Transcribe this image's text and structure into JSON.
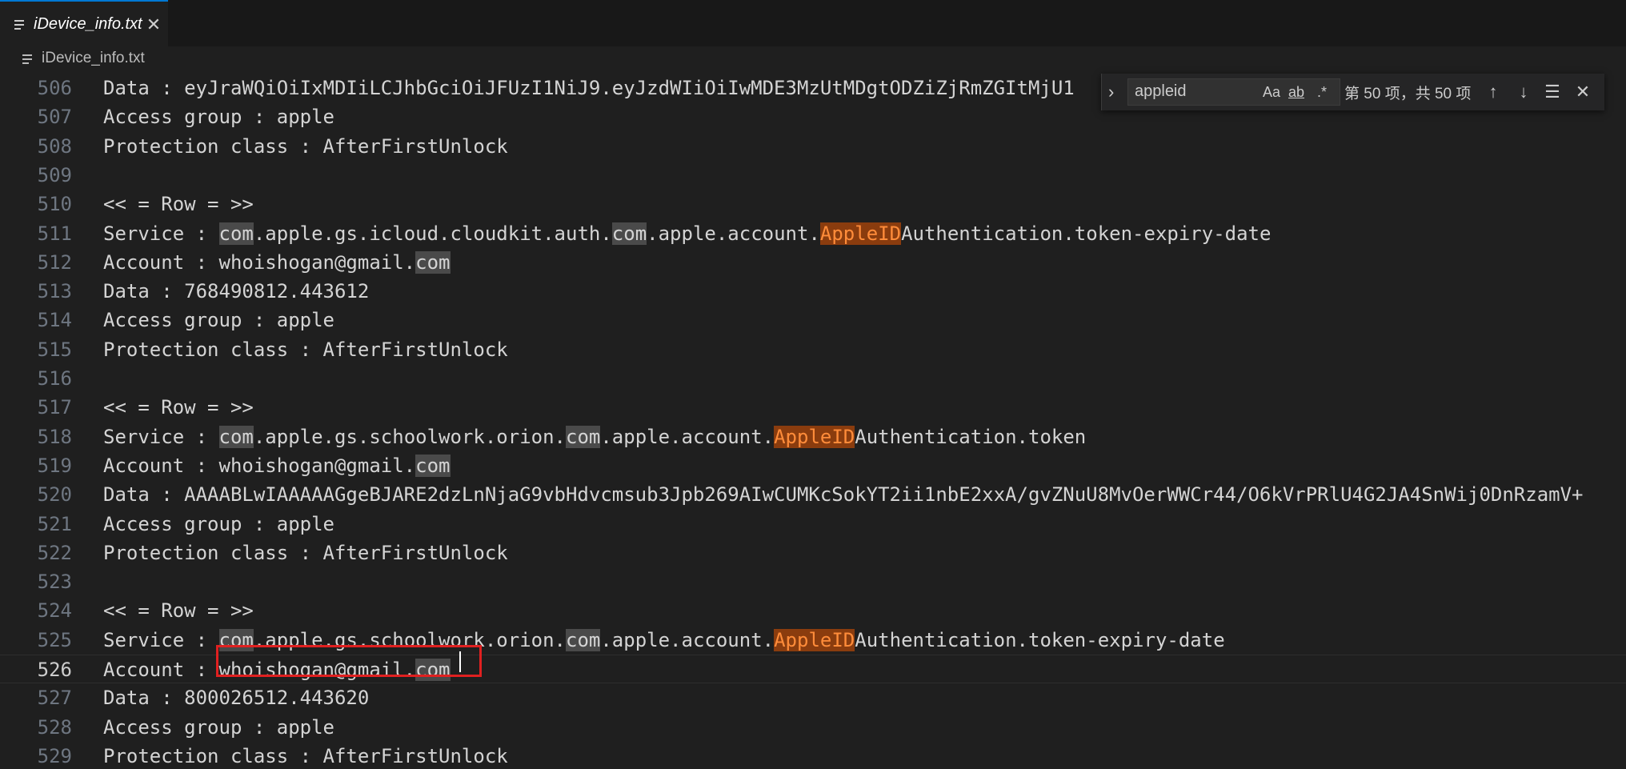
{
  "tab": {
    "title": "iDevice_info.txt",
    "icon": "lines-icon",
    "close_icon": "close-icon"
  },
  "breadcrumb": {
    "file": "iDevice_info.txt"
  },
  "find": {
    "query": "appleid",
    "match_case": "Aa",
    "whole_word": "ab",
    "regex": ".*",
    "count": "第 50 项，共 50 项"
  },
  "lines": [
    {
      "num": "506",
      "segs": [
        [
          "Data : eyJraWQiOiIxMDIiLCJhbGciOiJFUzI1NiJ9.eyJzdWIiOiIwMDE3MzUtMDgtODZiZjRmZGItMjU1",
          "n"
        ]
      ]
    },
    {
      "num": "507",
      "segs": [
        [
          "Access group : apple",
          "n"
        ]
      ]
    },
    {
      "num": "508",
      "segs": [
        [
          "Protection class : AfterFirstUnlock",
          "n"
        ]
      ]
    },
    {
      "num": "509",
      "segs": []
    },
    {
      "num": "510",
      "segs": [
        [
          "<< = Row = >>",
          "n"
        ]
      ]
    },
    {
      "num": "511",
      "segs": [
        [
          "Service : ",
          "n"
        ],
        [
          "com",
          "m"
        ],
        [
          ".apple.gs.icloud.cloudkit.auth.",
          "n"
        ],
        [
          "com",
          "m"
        ],
        [
          ".apple.account.",
          "n"
        ],
        [
          "AppleID",
          "h"
        ],
        [
          "Authentication.token-expiry-date",
          "n"
        ]
      ]
    },
    {
      "num": "512",
      "segs": [
        [
          "Account : whoishogan@gmail.",
          "n"
        ],
        [
          "com",
          "m"
        ]
      ]
    },
    {
      "num": "513",
      "segs": [
        [
          "Data : 768490812.443612",
          "n"
        ]
      ]
    },
    {
      "num": "514",
      "segs": [
        [
          "Access group : apple",
          "n"
        ]
      ]
    },
    {
      "num": "515",
      "segs": [
        [
          "Protection class : AfterFirstUnlock",
          "n"
        ]
      ]
    },
    {
      "num": "516",
      "segs": []
    },
    {
      "num": "517",
      "segs": [
        [
          "<< = Row = >>",
          "n"
        ]
      ]
    },
    {
      "num": "518",
      "segs": [
        [
          "Service : ",
          "n"
        ],
        [
          "com",
          "m"
        ],
        [
          ".apple.gs.schoolwork.orion.",
          "n"
        ],
        [
          "com",
          "m"
        ],
        [
          ".apple.account.",
          "n"
        ],
        [
          "AppleID",
          "h"
        ],
        [
          "Authentication.token",
          "n"
        ]
      ]
    },
    {
      "num": "519",
      "segs": [
        [
          "Account : whoishogan@gmail.",
          "n"
        ],
        [
          "com",
          "m"
        ]
      ]
    },
    {
      "num": "520",
      "segs": [
        [
          "Data : AAAABLwIAAAAAGgeBJARE2dzLnNjaG9vbHdvcmsub3Jpb269AIwCUMKcSokYT2ii1nbE2xxA/gvZNuU8MvOerWWCr44/O6kVrPRlU4G2JA4SnWij0DnRzamV+",
          "n"
        ]
      ]
    },
    {
      "num": "521",
      "segs": [
        [
          "Access group : apple",
          "n"
        ]
      ]
    },
    {
      "num": "522",
      "segs": [
        [
          "Protection class : AfterFirstUnlock",
          "n"
        ]
      ]
    },
    {
      "num": "523",
      "segs": []
    },
    {
      "num": "524",
      "segs": [
        [
          "<< = Row = >>",
          "n"
        ]
      ]
    },
    {
      "num": "525",
      "segs": [
        [
          "Service : ",
          "n"
        ],
        [
          "com",
          "m"
        ],
        [
          ".apple.gs.schoolwork.orion.",
          "n"
        ],
        [
          "com",
          "m"
        ],
        [
          ".apple.account.",
          "n"
        ],
        [
          "AppleID",
          "h"
        ],
        [
          "Authentication.token-expiry-date",
          "n"
        ]
      ]
    },
    {
      "num": "526",
      "segs": [
        [
          "Account : whoishogan@gmail.",
          "n"
        ],
        [
          "com",
          "m"
        ]
      ]
    },
    {
      "num": "527",
      "segs": [
        [
          "Data : 800026512.443620",
          "n"
        ]
      ]
    },
    {
      "num": "528",
      "segs": [
        [
          "Access group : apple",
          "n"
        ]
      ]
    },
    {
      "num": "529",
      "segs": [
        [
          "Protection class : AfterFirstUnlock",
          "n"
        ]
      ]
    }
  ],
  "active_line": "526",
  "colors": {
    "match_current": "#8a3c0e",
    "match_other": "#4a4a4a",
    "annotation_box": "#e02020"
  }
}
